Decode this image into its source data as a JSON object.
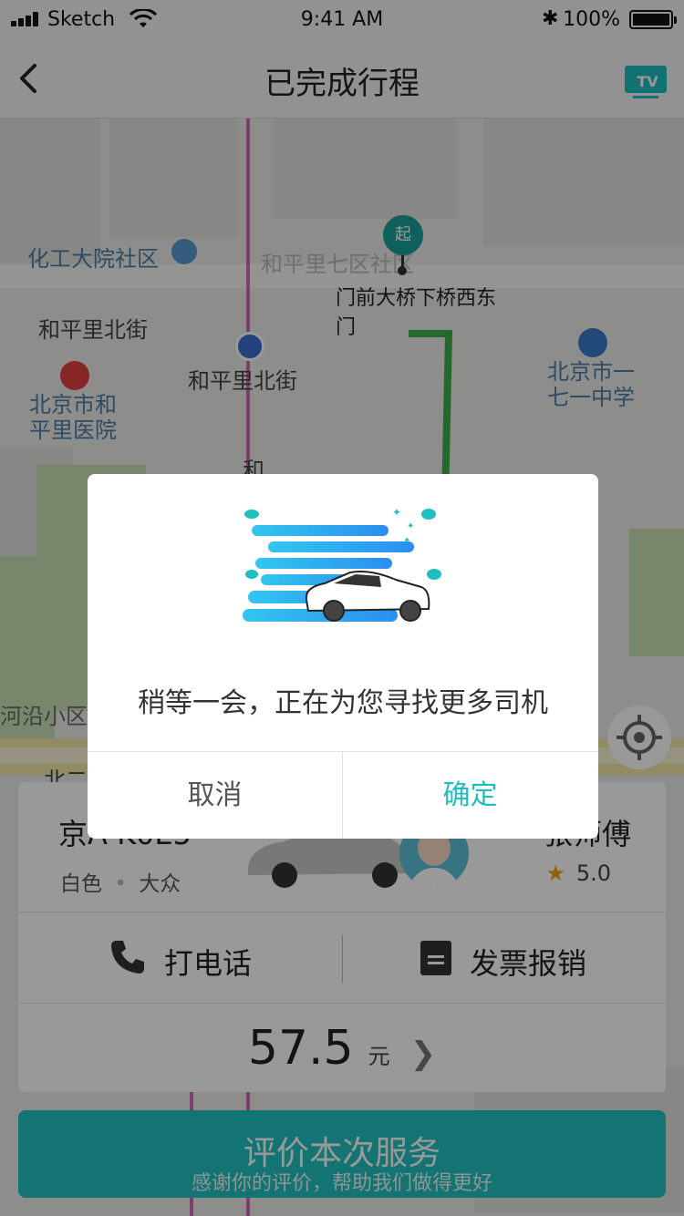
{
  "status": {
    "carrier": "Sketch",
    "time": "9:41 AM",
    "battery": "100%"
  },
  "nav": {
    "title": "已完成行程",
    "tv_label": "TV"
  },
  "map": {
    "labels": {
      "community1": "化工大院社区",
      "community2": "和平里七区社区",
      "street1": "和平里北街",
      "street2": "和平里北街",
      "hospital": "北京市和\n平里医院",
      "school": "北京市一\n七一中学",
      "road_frag1": "和",
      "river": "河沿小区",
      "start_address": "门前大桥下桥西东\n门",
      "road_frag2": "北二"
    },
    "start_marker": "起",
    "route_color": "#3fae4c"
  },
  "card": {
    "plate": "京A·K0E5",
    "car_color": "白色",
    "car_brand": "大众",
    "driver_name": "张师傅",
    "rating": "5.0",
    "call_label": "打电话",
    "invoice_label": "发票报销",
    "price": "57.5",
    "price_unit": "元"
  },
  "rate_button": {
    "title": "评价本次服务",
    "subtitle": "感谢你的评价，帮助我们做得更好"
  },
  "dialog": {
    "message": "稍等一会，正在为您寻找更多司机",
    "cancel": "取消",
    "confirm": "确定"
  },
  "colors": {
    "accent": "#1fbec0",
    "button": "#22c0c0"
  }
}
